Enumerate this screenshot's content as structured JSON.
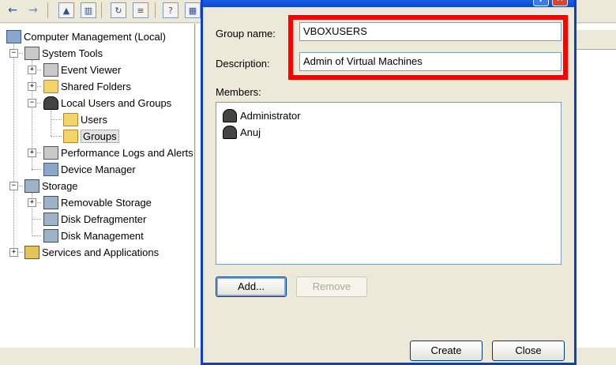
{
  "tree": {
    "items": [
      {
        "label": "Computer Management (Local)"
      },
      {
        "label": "System Tools"
      },
      {
        "label": "Event Viewer"
      },
      {
        "label": "Shared Folders"
      },
      {
        "label": "Local Users and Groups"
      },
      {
        "label": "Users"
      },
      {
        "label": "Groups"
      },
      {
        "label": "Performance Logs and Alerts"
      },
      {
        "label": "Device Manager"
      },
      {
        "label": "Storage"
      },
      {
        "label": "Removable Storage"
      },
      {
        "label": "Disk Defragmenter"
      },
      {
        "label": "Disk Management"
      },
      {
        "label": "Services and Applications"
      }
    ]
  },
  "dialog": {
    "group_name_label": "Group name:",
    "group_name_value": "VBOXUSERS",
    "description_label": "Description:",
    "description_value": "Admin of Virtual Machines",
    "members_label": "Members:",
    "members": [
      "Administrator",
      "Anuj"
    ],
    "add_label": "Add...",
    "remove_label": "Remove",
    "create_label": "Create",
    "close_label": "Close"
  },
  "colors": {
    "highlight_box": "#ff0000",
    "titlebar": "#0a47d8"
  }
}
